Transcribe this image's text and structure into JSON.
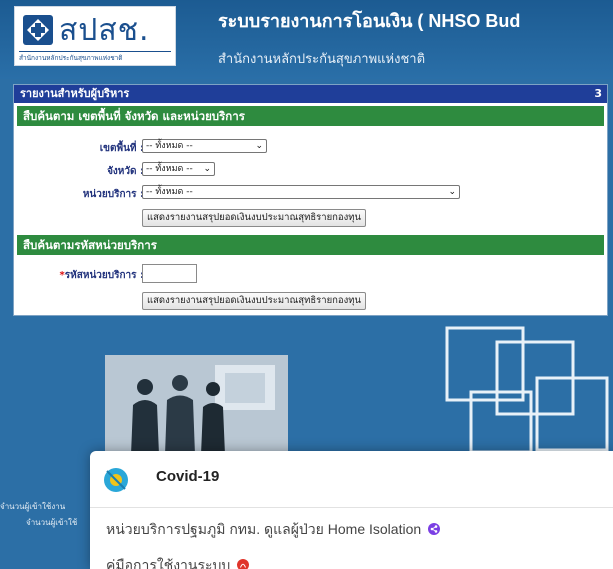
{
  "header": {
    "logo_text": "สปสช.",
    "logo_subtext": "สำนักงานหลักประกันสุขภาพแห่งชาติ",
    "title": "ระบบรายงานการโอนเงิน ( NHSO Bud",
    "subtitle": "สำนักงานหลักประกันสุขภาพแห่งชาติ"
  },
  "panel": {
    "title": "รายงานสำหรับผู้บริหาร",
    "number": "3",
    "section1": {
      "title": "สืบค้นตาม เขตพื้นที่ จังหวัด และหน่วยบริการ",
      "fields": [
        {
          "label": "เขตพื้นที่ :",
          "value": "-- ทั้งหมด --"
        },
        {
          "label": "จังหวัด :",
          "value": "-- ทั้งหมด --"
        },
        {
          "label": "หน่วยบริการ :",
          "value": "-- ทั้งหมด --"
        }
      ],
      "button": "แสดงรายงานสรุปยอดเงินงบประมาณสุทธิรายกองทุน"
    },
    "section2": {
      "title": "สืบค้นตามรหัสหน่วยบริการ",
      "required_mark": "*",
      "field_label": "รหัสหน่วยบริการ :",
      "field_value": "",
      "button": "แสดงรายงานสรุปยอดเงินงบประมาณสุทธิรายกองทุน"
    }
  },
  "side_texts": [
    "จำนวนผู้เข้าใช้งาน",
    "จำนวนผู้เข้าใช้"
  ],
  "popup": {
    "title": "Covid-19",
    "line1": "หน่วยบริการปฐมภูมิ กทม. ดูแลผู้ป่วย Home Isolation",
    "line2": "คู่มือการใช้งานระบบ"
  },
  "colors": {
    "header_bg": "#1c5b92",
    "page_bg": "#2c6fa6",
    "panel_head": "#1f3e99",
    "section_head": "#2e8b3f",
    "share_icon": "#7b3fe4",
    "pdf_icon": "#e0342a"
  }
}
